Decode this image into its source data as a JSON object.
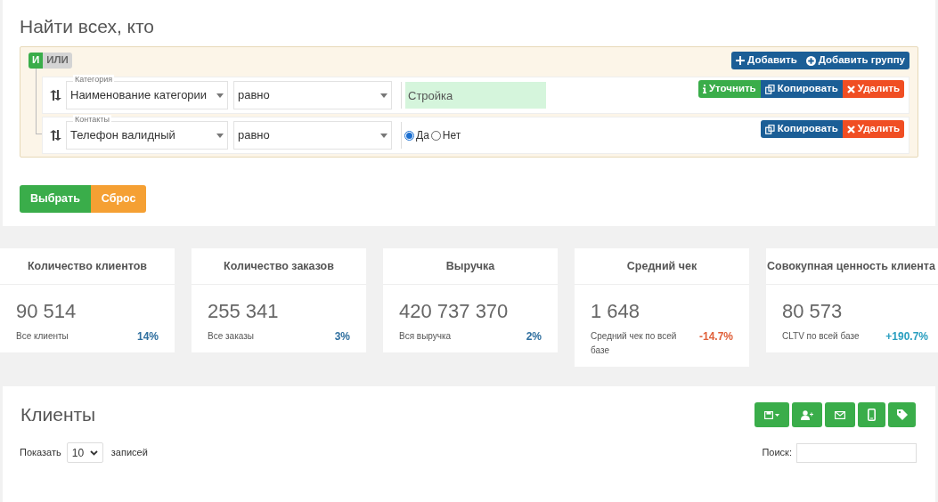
{
  "filter": {
    "title": "Найти всех, кто",
    "logic": [
      {
        "label": "И",
        "selected": true
      },
      {
        "label": "ИЛИ",
        "selected": false
      }
    ],
    "group_buttons": [
      {
        "kind": "add",
        "label": "Добавить"
      },
      {
        "kind": "add_group",
        "label": "Добавить группу"
      }
    ],
    "rules": [
      {
        "group_label": "Категория",
        "field": "Наименование категории",
        "operator": "равно",
        "kind": "text",
        "value": "Стройка",
        "buttons": [
          {
            "kind": "refine",
            "label": "Уточнить"
          },
          {
            "kind": "copy",
            "label": "Копировать"
          },
          {
            "kind": "delete",
            "label": "Удалить"
          }
        ]
      },
      {
        "group_label": "Контакты",
        "field": "Телефон валидный",
        "operator": "равно",
        "kind": "radio",
        "options": [
          {
            "label": "Да",
            "selected": true
          },
          {
            "label": "Нет",
            "selected": false
          }
        ],
        "buttons": [
          {
            "kind": "copy",
            "label": "Копировать"
          },
          {
            "kind": "delete",
            "label": "Удалить"
          }
        ]
      }
    ],
    "actions": [
      {
        "kind": "primary",
        "label": "Выбрать"
      },
      {
        "kind": "warning",
        "label": "Сброс"
      }
    ]
  },
  "stats": [
    {
      "title": "Количество клиентов",
      "value": "90 514",
      "caption": "Все клиенты",
      "change": "14%",
      "color": "#2f6f9f"
    },
    {
      "title": "Количество заказов",
      "value": "255 341",
      "caption": "Все заказы",
      "change": "3%",
      "color": "#2f6f9f"
    },
    {
      "title": "Выручка",
      "value": "420 737 370",
      "caption": "Вся выручка",
      "change": "2%",
      "color": "#2f6f9f"
    },
    {
      "title": "Средний чек",
      "value": "1 648",
      "caption": "Средний чек по всей базе",
      "change": "-14.7%",
      "color": "#e0603a"
    },
    {
      "title": "Совокупная ценность клиента",
      "value": "80 573",
      "caption": "CLTV по всей базе",
      "change": "+190.7%",
      "color": "#2a9fc0"
    }
  ],
  "clients": {
    "title": "Клиенты",
    "toolbar": [
      {
        "kind": "save"
      },
      {
        "kind": "add_user"
      },
      {
        "kind": "mail"
      },
      {
        "kind": "phone"
      },
      {
        "kind": "tag"
      }
    ],
    "length_label": "Показать",
    "length_value": "10",
    "length_suffix": "записей",
    "search_label": "Поиск:"
  }
}
